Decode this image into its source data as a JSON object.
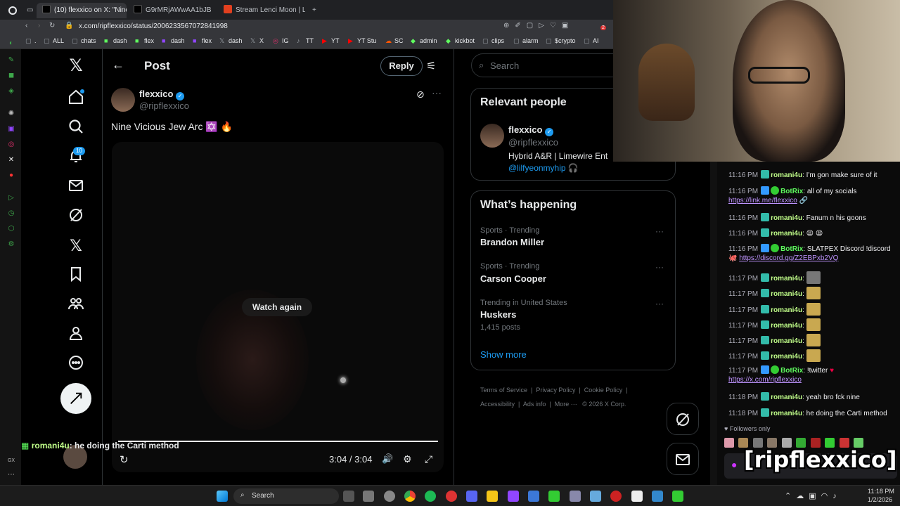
{
  "browser": {
    "tabs": [
      {
        "label": "(10) flexxico on X: \"Nine V",
        "active": true
      },
      {
        "label": "G9rMRjAWwAA1bJB (945",
        "active": false
      },
      {
        "label": "Stream Lenci Moon | Liste",
        "active": false
      }
    ],
    "new_tab": "+",
    "url": "x.com/ripflexxico/status/2006233567072841998",
    "bookmarks": [
      "ALL",
      "chats",
      "dash",
      "flex",
      "dash",
      "flex",
      "dash",
      "X",
      "IG",
      "TT",
      "YT",
      "YT Stu",
      "SC",
      "admin",
      "kickbot",
      "clips",
      "alarm",
      "$crypto",
      "AI"
    ],
    "extension_badge": "2"
  },
  "x_nav": {
    "notifications_badge": "10",
    "icons": [
      "x-logo-icon",
      "home-icon",
      "explore-icon",
      "notifications-icon",
      "messages-icon",
      "grok-icon",
      "premium-icon",
      "bookmarks-icon",
      "communities-icon",
      "profile-icon",
      "more-icon"
    ]
  },
  "post_header": {
    "title": "Post",
    "reply_label": "Reply"
  },
  "post": {
    "display_name": "flexxico",
    "handle": "@ripflexxico",
    "text": "Nine Vicious Jew Arc ✡️ 🔥",
    "watch_again": "Watch again",
    "time": "3:04 / 3:04",
    "progress": 1.0
  },
  "search": {
    "placeholder": "Search"
  },
  "relevant": {
    "title": "Relevant people",
    "name": "flexxico",
    "handle": "@ripflexxico",
    "bio": "Hybrid A&R | Limewire Ent",
    "link": "@lilfyeonmyhip 🎧"
  },
  "happening": {
    "title": "What’s happening",
    "items": [
      {
        "context": "Sports · Trending",
        "name": "Brandon Miller",
        "count": ""
      },
      {
        "context": "Sports · Trending",
        "name": "Carson Cooper",
        "count": ""
      },
      {
        "context": "Trending in United States",
        "name": "Huskers",
        "count": "1,415 posts"
      }
    ],
    "show_more": "Show more"
  },
  "footer": {
    "links": [
      "Terms of Service",
      "Privacy Policy",
      "Cookie Policy",
      "Accessibility",
      "Ads info",
      "More ···",
      "© 2026 X Corp."
    ]
  },
  "chat": {
    "lines": [
      {
        "time": "11:16 PM",
        "user": "romani4u",
        "msg": "I'm gon make sure of it",
        "link": ""
      },
      {
        "time": "11:16 PM",
        "user": "BotRix",
        "msg": "all of my socials",
        "link": "https://link.me/flexxico"
      },
      {
        "time": "11:16 PM",
        "user": "romani4u",
        "msg": "Fanum n his goons",
        "link": ""
      },
      {
        "time": "11:16 PM",
        "user": "romani4u",
        "msg": "😫 😫",
        "link": ""
      },
      {
        "time": "11:16 PM",
        "user": "BotRix",
        "msg": "SLATPEX Discord !discord",
        "link": "https://discord.gg/Z2EBPxb2VQ"
      },
      {
        "time": "11:17 PM",
        "user": "romani4u",
        "msg": "",
        "link": ""
      },
      {
        "time": "11:17 PM",
        "user": "romani4u",
        "msg": "",
        "link": ""
      },
      {
        "time": "11:17 PM",
        "user": "romani4u",
        "msg": "",
        "link": ""
      },
      {
        "time": "11:17 PM",
        "user": "romani4u",
        "msg": "",
        "link": ""
      },
      {
        "time": "11:17 PM",
        "user": "romani4u",
        "msg": "",
        "link": ""
      },
      {
        "time": "11:17 PM",
        "user": "romani4u",
        "msg": "",
        "link": ""
      },
      {
        "time": "11:17 PM",
        "user": "BotRix",
        "msg": "!twitter",
        "link": "https://x.com/ripflexxico"
      },
      {
        "time": "11:18 PM",
        "user": "romani4u",
        "msg": "yeah bro fck nine",
        "link": ""
      },
      {
        "time": "11:18 PM",
        "user": "romani4u",
        "msg": "he doing the Carti method",
        "link": ""
      }
    ],
    "followers_only": "Followers only"
  },
  "overlay": {
    "chat_user": "romani4u",
    "chat_msg": ": he doing the Carti method",
    "watermark": "[ripflexxico]"
  },
  "taskbar": {
    "search_label": "Search",
    "time": "11:18 PM",
    "date": "1/2/2026"
  },
  "colors": {
    "accent": "#1d9bf0",
    "chat_green": "#c1ff8a"
  }
}
